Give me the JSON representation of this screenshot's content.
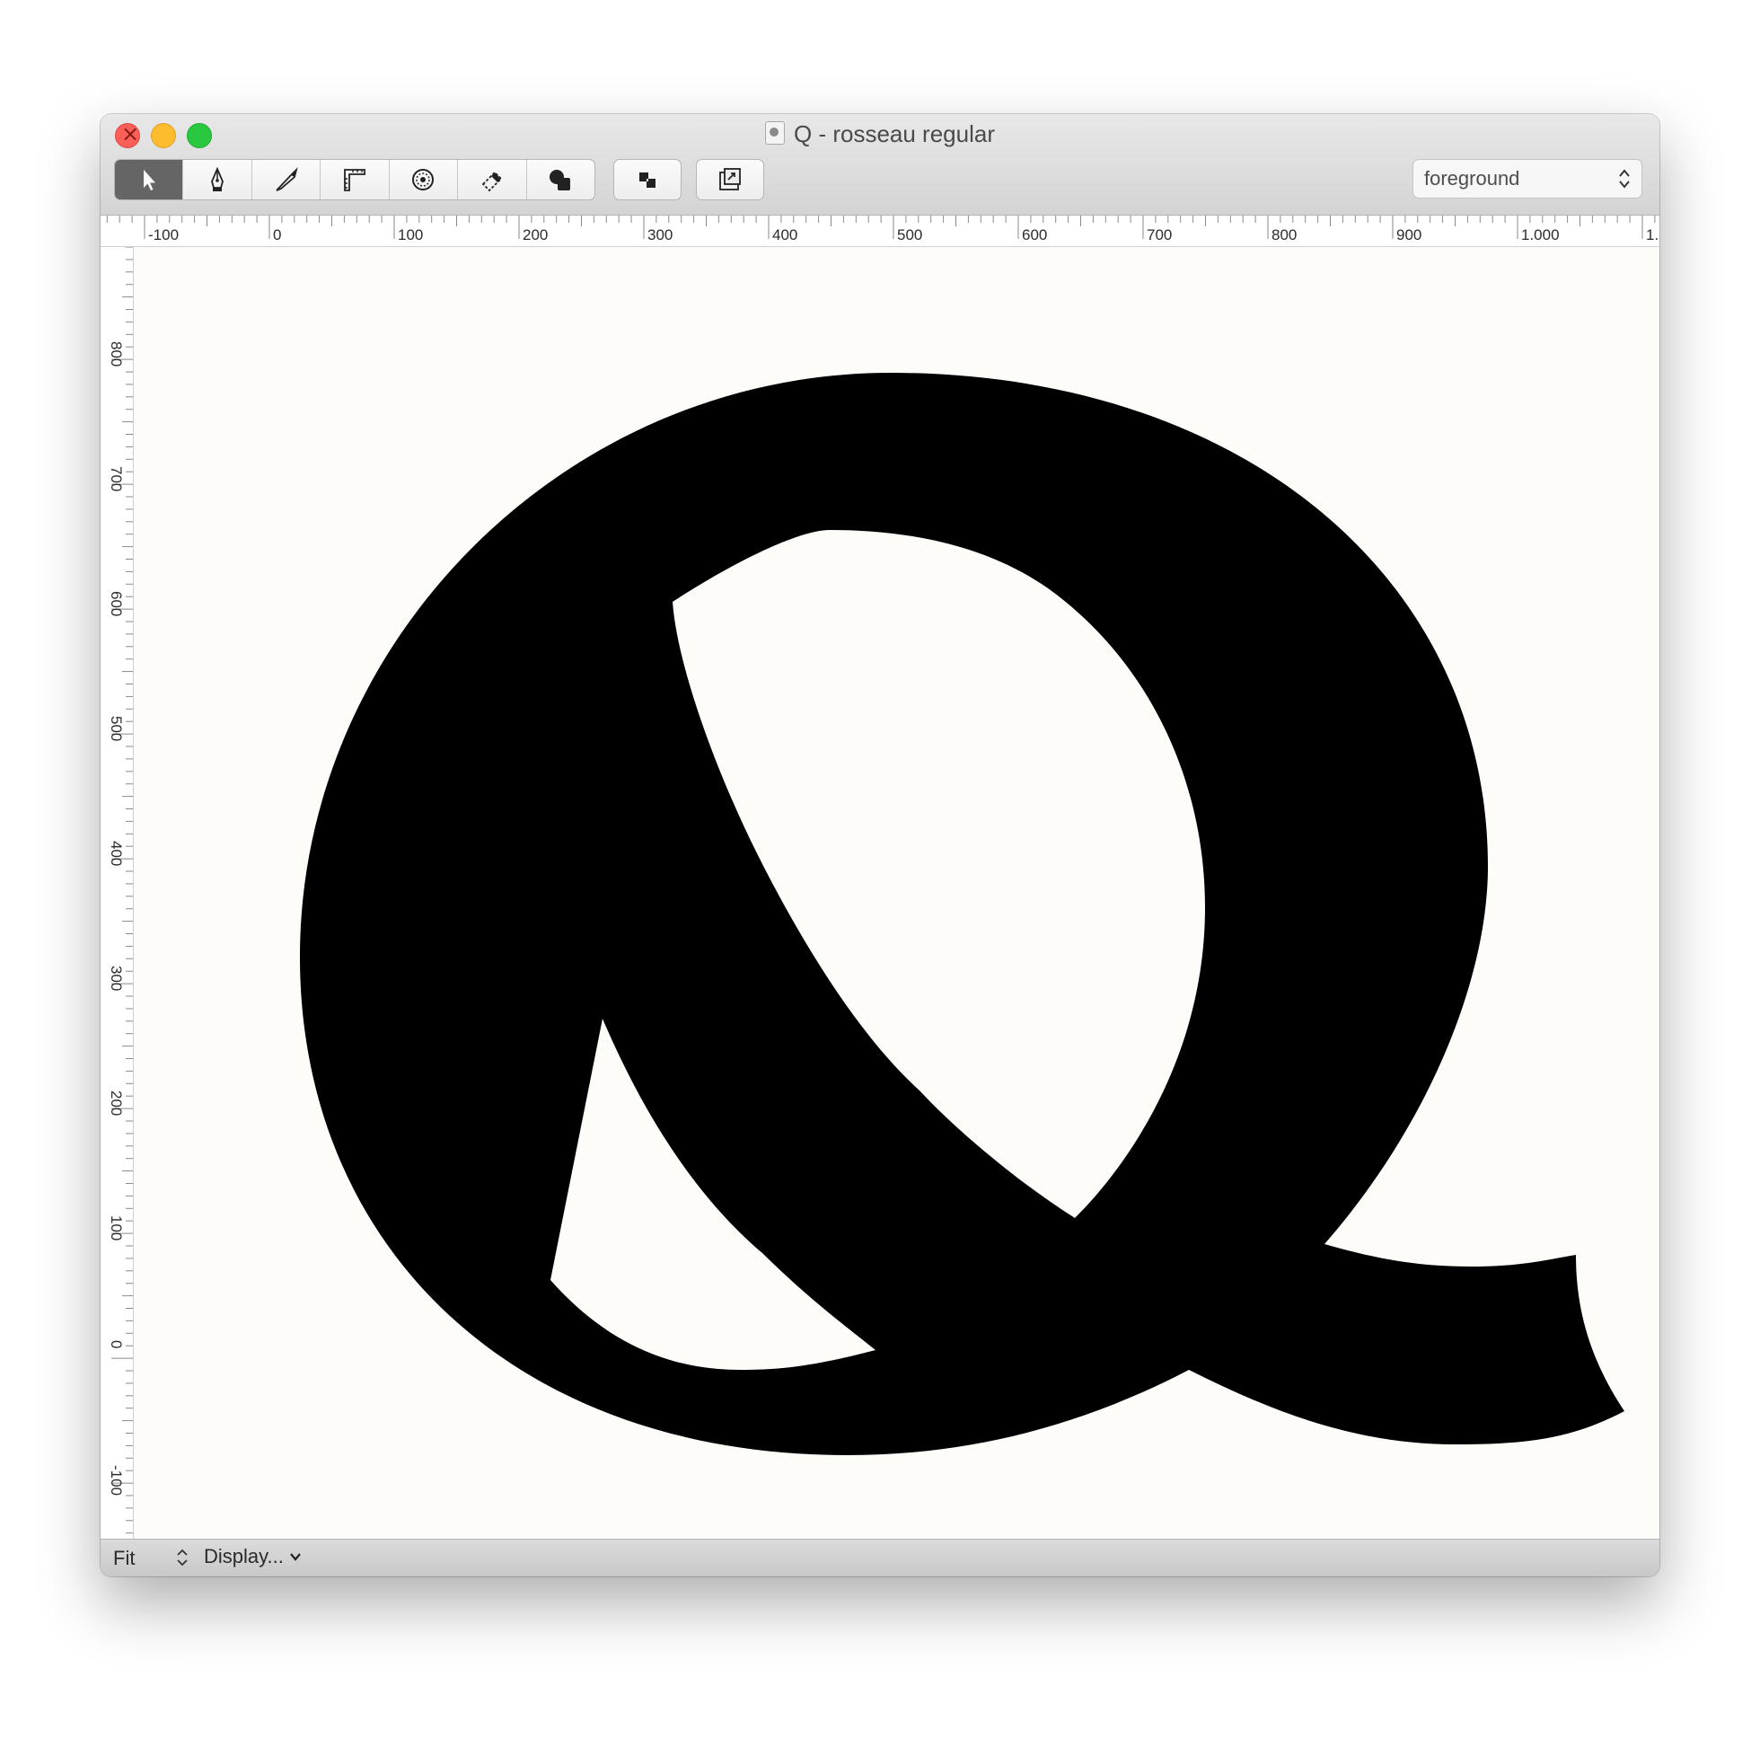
{
  "window": {
    "title": "Q - rosseau regular",
    "icons": {
      "document": "font-document-icon"
    }
  },
  "toolbar": {
    "tools": [
      {
        "name": "pointer",
        "icon": "arrow-pointer-icon",
        "active": true
      },
      {
        "name": "pen",
        "icon": "pen-nib-icon",
        "active": false
      },
      {
        "name": "knife",
        "icon": "knife-icon",
        "active": false
      },
      {
        "name": "measure",
        "icon": "measure-icon",
        "active": false
      },
      {
        "name": "primitive-shapes",
        "icon": "gear-circle-icon",
        "active": false
      },
      {
        "name": "eraser",
        "icon": "eraser-icon",
        "active": false
      },
      {
        "name": "shapes",
        "icon": "shapes-icon",
        "active": false
      }
    ],
    "extra_buttons": [
      {
        "name": "layers",
        "icon": "overlap-squares-icon"
      },
      {
        "name": "transform",
        "icon": "transform-box-icon"
      }
    ],
    "layer_select": {
      "value": "foreground",
      "icon": "updown-chevron-icon"
    }
  },
  "rulers": {
    "horizontal_labels": [
      "-100",
      "0",
      "100",
      "200",
      "300",
      "400",
      "500",
      "600",
      "700",
      "800",
      "900",
      "1.000",
      "1."
    ],
    "vertical_labels": [
      "800",
      "700",
      "600",
      "500",
      "400",
      "300",
      "200",
      "100",
      "0",
      "-100"
    ]
  },
  "statusbar": {
    "zoom": "Fit",
    "zoom_icon": "updown-stepper-icon",
    "display_menu": "Display...",
    "display_icon": "chevron-down-icon"
  },
  "colors": {
    "canvas": "#fdfcf9",
    "glyph": "#000000",
    "active_tool": "#656565"
  }
}
